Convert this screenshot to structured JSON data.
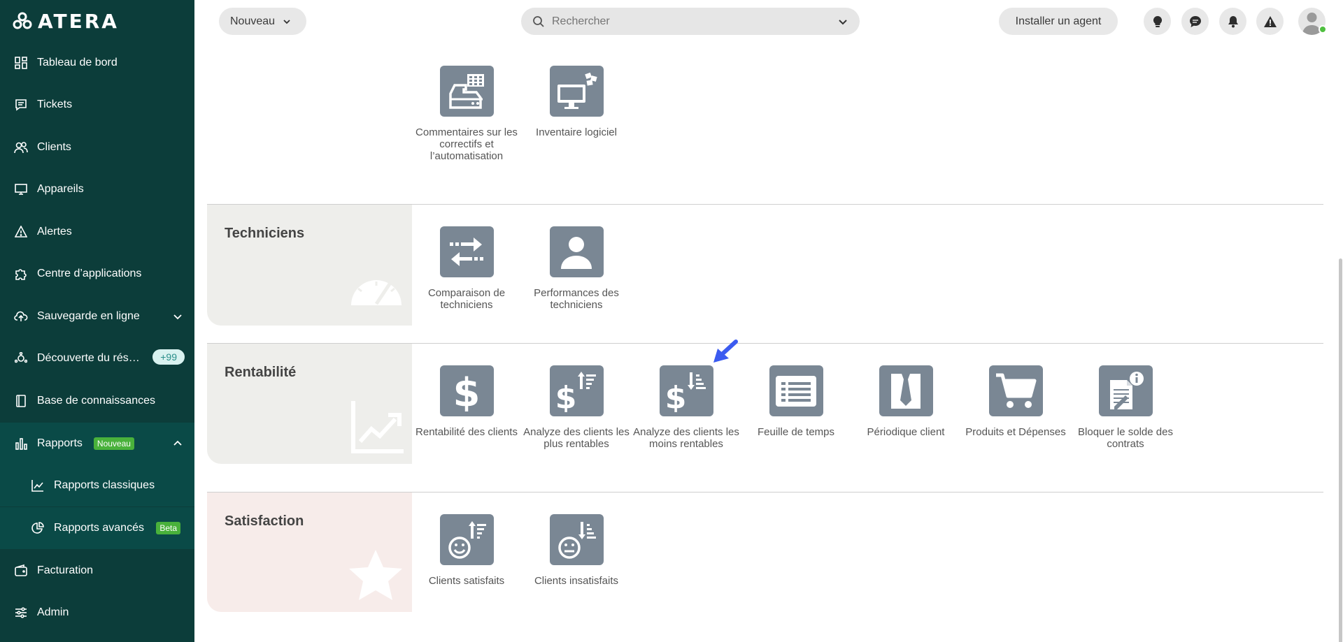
{
  "app": {
    "logo_text": "ATERA"
  },
  "sidebar": {
    "items": [
      {
        "label": "Tableau de bord"
      },
      {
        "label": "Tickets"
      },
      {
        "label": "Clients"
      },
      {
        "label": "Appareils"
      },
      {
        "label": "Alertes"
      },
      {
        "label": "Centre d’applications"
      },
      {
        "label": "Sauvegarde en ligne"
      },
      {
        "label": "Découverte du rés…",
        "badge": "+99"
      },
      {
        "label": "Base de connaissances"
      },
      {
        "label": "Rapports",
        "badge": "Nouveau"
      },
      {
        "label": "Rapports classiques"
      },
      {
        "label": "Rapports avancés",
        "badge": "Beta"
      },
      {
        "label": "Facturation"
      },
      {
        "label": "Admin"
      }
    ]
  },
  "topbar": {
    "new_label": "Nouveau",
    "search_placeholder": "Rechercher",
    "install_agent_label": "Installer un agent"
  },
  "sections": {
    "top": {
      "tiles": [
        {
          "label": "Commentaires sur les correctifs et l’automatisation"
        },
        {
          "label": "Inventaire logiciel"
        }
      ]
    },
    "technicians": {
      "title": "Techniciens",
      "tiles": [
        {
          "label": "Comparaison de techniciens"
        },
        {
          "label": "Performances des techniciens"
        }
      ]
    },
    "profitability": {
      "title": "Rentabilité",
      "tiles": [
        {
          "label": "Rentabilité des clients"
        },
        {
          "label": "Analyze des clients les plus rentables"
        },
        {
          "label": "Analyze des clients les moins rentables"
        },
        {
          "label": "Feuille de temps"
        },
        {
          "label": "Périodique client"
        },
        {
          "label": "Produits et Dépenses"
        },
        {
          "label": "Bloquer le solde des contrats"
        }
      ]
    },
    "satisfaction": {
      "title": "Satisfaction",
      "tiles": [
        {
          "label": "Clients satisfaits"
        },
        {
          "label": "Clients insatisfaits"
        }
      ]
    }
  },
  "colors": {
    "sidebar_bg": "#0c3d3a",
    "tile_bg": "#7a8794",
    "badge_green": "#49b13b",
    "pointer_arrow": "#3b5bf0"
  }
}
